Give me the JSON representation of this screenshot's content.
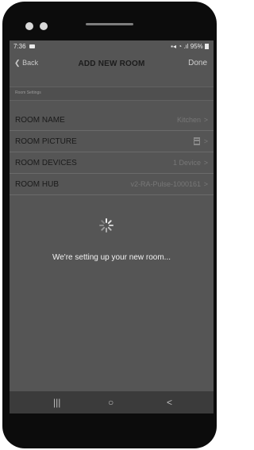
{
  "status": {
    "time": "7:36",
    "right": "95%"
  },
  "nav": {
    "back": "Back",
    "title": "ADD NEW ROOM",
    "done": "Done"
  },
  "section": {
    "header": "Room Settings"
  },
  "rows": [
    {
      "label": "ROOM NAME",
      "value": "Kitchen"
    },
    {
      "label": "ROOM PICTURE",
      "value": ""
    },
    {
      "label": "ROOM DEVICES",
      "value": "1 Device"
    },
    {
      "label": "ROOM HUB",
      "value": "v2-RA-Pulse-1000161"
    }
  ],
  "message": "We're setting up your new room...",
  "sysnav": {
    "recents": "|||",
    "home": "○",
    "back": "<"
  }
}
